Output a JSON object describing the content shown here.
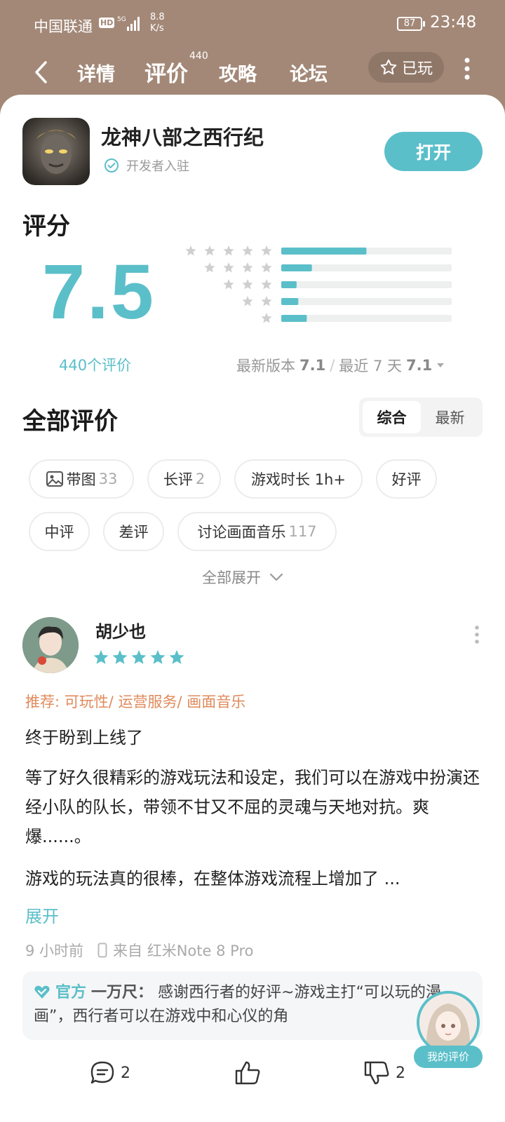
{
  "status_bar": {
    "carrier": "中国联通",
    "hd": "HD",
    "network": "5G",
    "speed_value": "8.8",
    "speed_unit": "K/s",
    "battery": "87",
    "time": "23:48"
  },
  "nav": {
    "tabs": [
      "详情",
      "评价",
      "攻略",
      "论坛"
    ],
    "active_tab": 1,
    "review_count_badge": "440",
    "played_label": "已玩"
  },
  "game": {
    "name": "龙神八部之西行纪",
    "developer_label": "开发者入驻",
    "open_label": "打开"
  },
  "rating": {
    "section_title": "评分",
    "score": "7.5",
    "count_label": "440个评价",
    "distribution": [
      {
        "stars": 5,
        "fraction": 0.5
      },
      {
        "stars": 4,
        "fraction": 0.18
      },
      {
        "stars": 3,
        "fraction": 0.09
      },
      {
        "stars": 2,
        "fraction": 0.1
      },
      {
        "stars": 1,
        "fraction": 0.15
      }
    ],
    "latest_version_label": "最新版本",
    "latest_version_score": "7.1",
    "separator": "/",
    "recent_label": "最近 7 天",
    "recent_score": "7.1"
  },
  "reviews_section": {
    "title": "全部评价",
    "sort_options": [
      "综合",
      "最新"
    ],
    "active_sort": 0,
    "filters": [
      {
        "label": "带图",
        "count": "33"
      },
      {
        "label": "长评",
        "count": "2"
      },
      {
        "label": "游戏时长 1h+",
        "count": ""
      },
      {
        "label": "好评",
        "count": ""
      },
      {
        "label": "中评",
        "count": ""
      },
      {
        "label": "差评",
        "count": ""
      },
      {
        "label": "讨论画面音乐",
        "count": "117"
      }
    ],
    "expand_all": "全部展开"
  },
  "review": {
    "user": "胡少也",
    "stars": 5,
    "recommend": "推荐: 可玩性/ 运营服务/ 画面音乐",
    "title": "终于盼到上线了",
    "para1": "等了好久很精彩的游戏玩法和设定，我们可以在游戏中扮演还经小队的队长，带领不甘又不屈的灵魂与天地对抗。爽爆......。",
    "para2": "游戏的玩法真的很棒，在整体游戏流程上增加了 ...",
    "expand": "展开",
    "time": "9 小时前",
    "device": "来自 红米Note 8 Pro",
    "reply_official": "官方",
    "reply_dev": "一万尺：",
    "reply_text": "感谢西行者的好评~游戏主打“可以玩的漫画”，西行者可以在游戏中和心仪的角",
    "my_review_label": "我的评价",
    "comments": "2",
    "dislikes": "2"
  },
  "colors": {
    "accent": "#5bbfc9",
    "recommend": "#e08a5b",
    "header_bg": "#a38877"
  },
  "icons": [
    "back-arrow-icon",
    "star-outline-icon",
    "more-vertical-icon",
    "verified-check-icon",
    "image-icon",
    "chevron-down-icon",
    "phone-icon",
    "heart-official-icon",
    "comment-icon",
    "thumbs-up-icon",
    "thumbs-down-icon"
  ]
}
